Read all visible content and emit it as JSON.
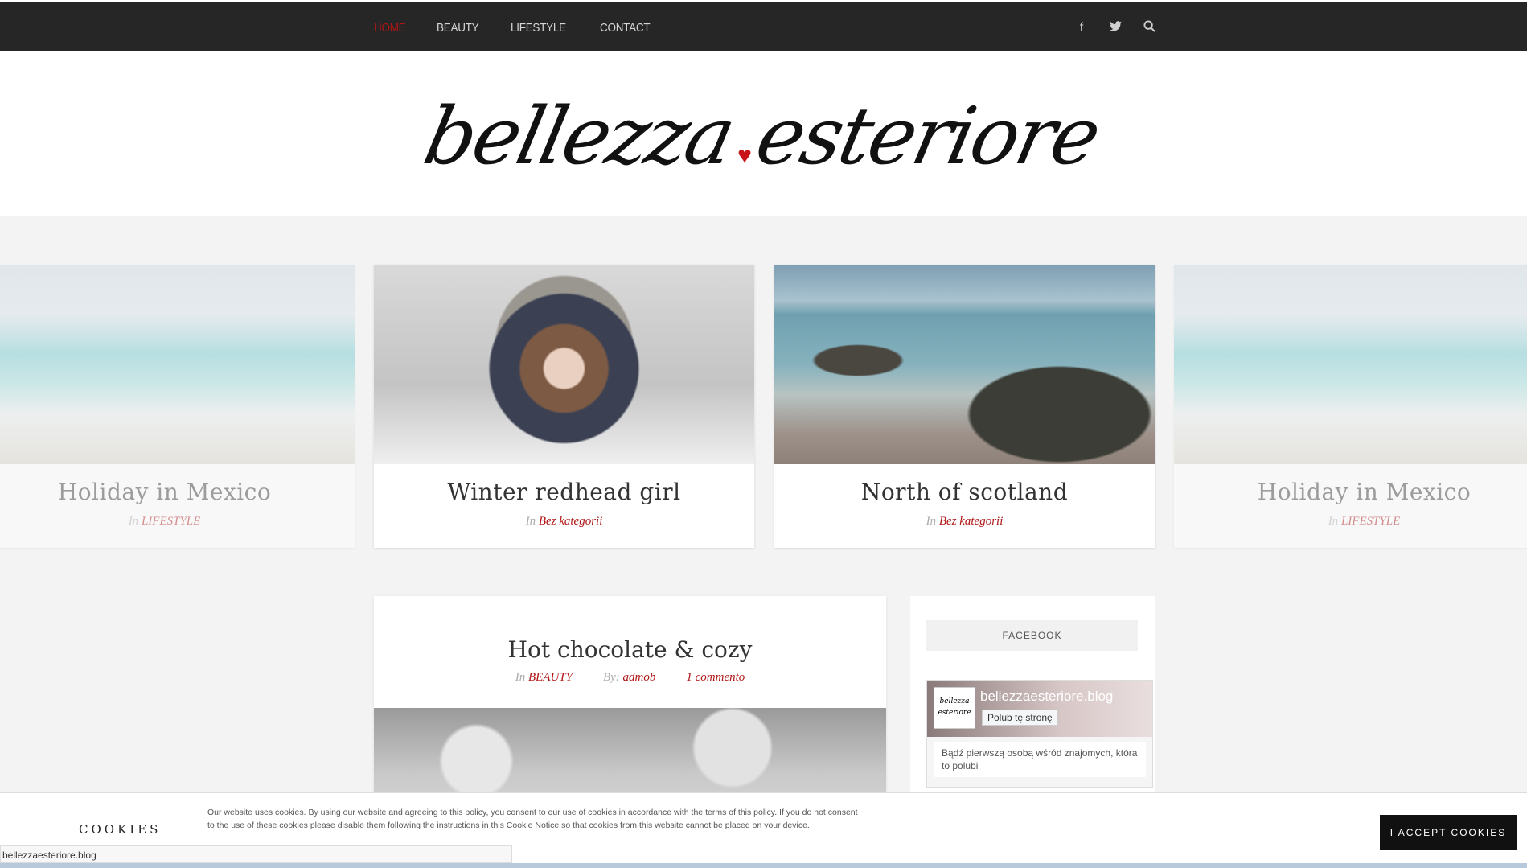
{
  "nav": {
    "home": "HOME",
    "beauty": "BEAUTY",
    "lifestyle": "LIFESTYLE",
    "contact": "CONTACT"
  },
  "social": {
    "facebook_icon": "f",
    "twitter_icon": "t",
    "search_icon": "search"
  },
  "logo": {
    "part1": "bellezza",
    "heart": "♥",
    "part2": "esteriore"
  },
  "slides": [
    {
      "title": "Holiday in Mexico",
      "in": "In",
      "category": "LIFESTYLE"
    },
    {
      "title": "Winter redhead girl",
      "in": "In",
      "category": "Bez kategorii"
    },
    {
      "title": "North of scotland",
      "in": "In",
      "category": "Bez kategorii"
    },
    {
      "title": "Holiday in Mexico",
      "in": "In",
      "category": "LIFESTYLE"
    }
  ],
  "post": {
    "title": "Hot chocolate & cozy",
    "in": "In",
    "category": "BEAUTY",
    "by": "By:",
    "author": "admob",
    "comments": "1 commento"
  },
  "widget": {
    "heading": "FACEBOOK",
    "page_name": "bellezzaesteriore.blog",
    "like_label": "Polub tę stronę",
    "first_friend": "Bądź pierwszą osobą wśród znajomych, która to polubi",
    "thumb": "bellezza esteriore"
  },
  "cookies": {
    "label": "COOKIES",
    "text": "Our website uses cookies. By using our website and agreeing to this policy, you consent to our use of cookies in accordance with the terms of this policy. If you do not consent to the use of these cookies please disable them following the instructions in this Cookie Notice so that cookies from this website cannot be placed on your device.",
    "accept": "I ACCEPT COOKIES"
  },
  "statusbar": "bellezzaesteriore.blog",
  "colors": {
    "accent": "#b01414",
    "topbar": "#262626",
    "heart": "#c8131b"
  }
}
